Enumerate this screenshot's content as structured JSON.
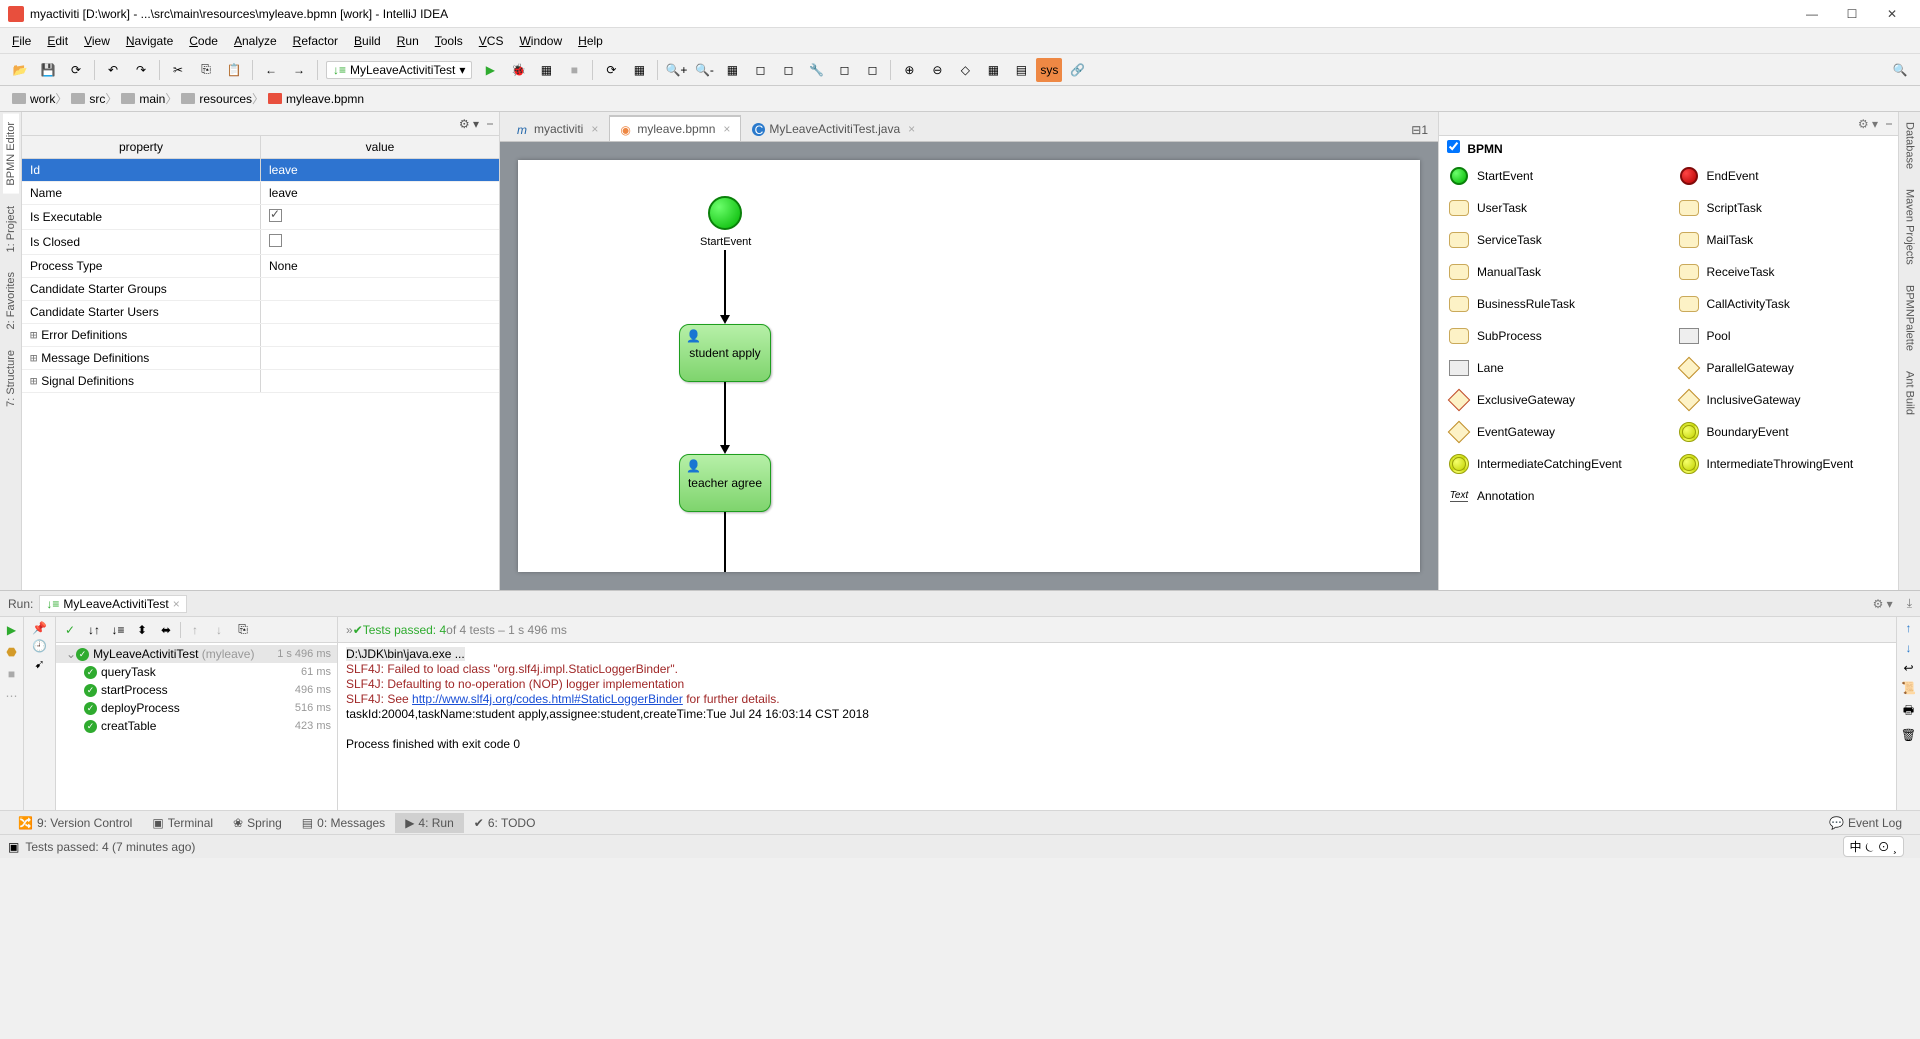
{
  "window": {
    "title": "myactiviti [D:\\work] - ...\\src\\main\\resources\\myleave.bpmn [work] - IntelliJ IDEA"
  },
  "menu": [
    "File",
    "Edit",
    "View",
    "Navigate",
    "Code",
    "Analyze",
    "Refactor",
    "Build",
    "Run",
    "Tools",
    "VCS",
    "Window",
    "Help"
  ],
  "runconfig": "MyLeaveActivitiTest",
  "breadcrumb": [
    "work",
    "src",
    "main",
    "resources",
    "myleave.bpmn"
  ],
  "props": {
    "headers": {
      "k": "property",
      "v": "value"
    },
    "rows": [
      {
        "k": "Id",
        "v": "leave",
        "sel": true
      },
      {
        "k": "Name",
        "v": "leave"
      },
      {
        "k": "Is Executable",
        "v": "",
        "check": true,
        "checked": true
      },
      {
        "k": "Is Closed",
        "v": "",
        "check": true,
        "checked": false
      },
      {
        "k": "Process Type",
        "v": "None"
      },
      {
        "k": "Candidate Starter Groups",
        "v": ""
      },
      {
        "k": "Candidate Starter Users",
        "v": ""
      },
      {
        "k": "Error Definitions",
        "v": "",
        "exp": true
      },
      {
        "k": "Message Definitions",
        "v": "",
        "exp": true
      },
      {
        "k": "Signal Definitions",
        "v": "",
        "exp": true
      }
    ]
  },
  "tabs": [
    {
      "label": "myactiviti",
      "icon": "m",
      "active": false
    },
    {
      "label": "myleave.bpmn",
      "icon": "bpmn",
      "active": true
    },
    {
      "label": "MyLeaveActivitiTest.java",
      "icon": "java",
      "active": false
    }
  ],
  "tabs_right": "⊟1",
  "diagram": {
    "start_label": "StartEvent",
    "task1": "student apply",
    "task2": "teacher agree"
  },
  "palette": {
    "title": "BPMN",
    "items": [
      {
        "label": "StartEvent",
        "shape": "circle-green"
      },
      {
        "label": "EndEvent",
        "shape": "circle-red"
      },
      {
        "label": "UserTask",
        "shape": "rrect"
      },
      {
        "label": "ScriptTask",
        "shape": "rrect"
      },
      {
        "label": "ServiceTask",
        "shape": "rrect"
      },
      {
        "label": "MailTask",
        "shape": "rrect"
      },
      {
        "label": "ManualTask",
        "shape": "rrect"
      },
      {
        "label": "ReceiveTask",
        "shape": "rrect"
      },
      {
        "label": "BusinessRuleTask",
        "shape": "rrect"
      },
      {
        "label": "CallActivityTask",
        "shape": "rrect"
      },
      {
        "label": "SubProcess",
        "shape": "rrect"
      },
      {
        "label": "Pool",
        "shape": "rect"
      },
      {
        "label": "Lane",
        "shape": "rect"
      },
      {
        "label": "ParallelGateway",
        "shape": "diamond"
      },
      {
        "label": "ExclusiveGateway",
        "shape": "diamond-red"
      },
      {
        "label": "InclusiveGateway",
        "shape": "diamond"
      },
      {
        "label": "EventGateway",
        "shape": "diamond"
      },
      {
        "label": "BoundaryEvent",
        "shape": "circle-yg"
      },
      {
        "label": "IntermediateCatchingEvent",
        "shape": "circle-yg"
      },
      {
        "label": "IntermediateThrowingEvent",
        "shape": "circle-yg"
      },
      {
        "label": "Annotation",
        "shape": "text"
      }
    ]
  },
  "left_tabs": [
    "BPMN Editor",
    "1: Project",
    "2: Favorites",
    "7: Structure"
  ],
  "right_tabs": [
    "Database",
    "Maven Projects",
    "BPMNPalette",
    "Ant Build"
  ],
  "run": {
    "title": "Run:",
    "config": "MyLeaveActivitiTest",
    "summary_pre": "»  ",
    "summary_pass": "Tests passed: 4",
    "summary_rest": " of 4 tests – 1 s 496 ms",
    "tree": [
      {
        "name": "MyLeaveActivitiTest",
        "pkg": "(myleave)",
        "time": "1 s 496 ms",
        "depth": 0,
        "sel": true
      },
      {
        "name": "queryTask",
        "time": "61 ms",
        "depth": 1
      },
      {
        "name": "startProcess",
        "time": "496 ms",
        "depth": 1
      },
      {
        "name": "deployProcess",
        "time": "516 ms",
        "depth": 1
      },
      {
        "name": "creatTable",
        "time": "423 ms",
        "depth": 1
      }
    ],
    "console": {
      "l1": "D:\\JDK\\bin\\java.exe ...",
      "l2": "SLF4J: Failed to load class \"org.slf4j.impl.StaticLoggerBinder\".",
      "l3": "SLF4J: Defaulting to no-operation (NOP) logger implementation",
      "l4a": "SLF4J: See ",
      "l4b": "http://www.slf4j.org/codes.html#StaticLoggerBinder",
      "l4c": " for further details.",
      "l5": "taskId:20004,taskName:student apply,assignee:student,createTime:Tue Jul 24 16:03:14 CST 2018",
      "l6": "",
      "l7": "Process finished with exit code 0"
    }
  },
  "bottom_tabs": [
    {
      "label": "9: Version Control",
      "icon": "🔀"
    },
    {
      "label": "Terminal",
      "icon": "▣"
    },
    {
      "label": "Spring",
      "icon": "❀"
    },
    {
      "label": "0: Messages",
      "icon": "▤"
    },
    {
      "label": "4: Run",
      "icon": "▶",
      "active": true
    },
    {
      "label": "6: TODO",
      "icon": "✔"
    }
  ],
  "event_log": "Event Log",
  "status": "Tests passed: 4 (7 minutes ago)",
  "ime": "中 ⏾ ⊙ ¸"
}
